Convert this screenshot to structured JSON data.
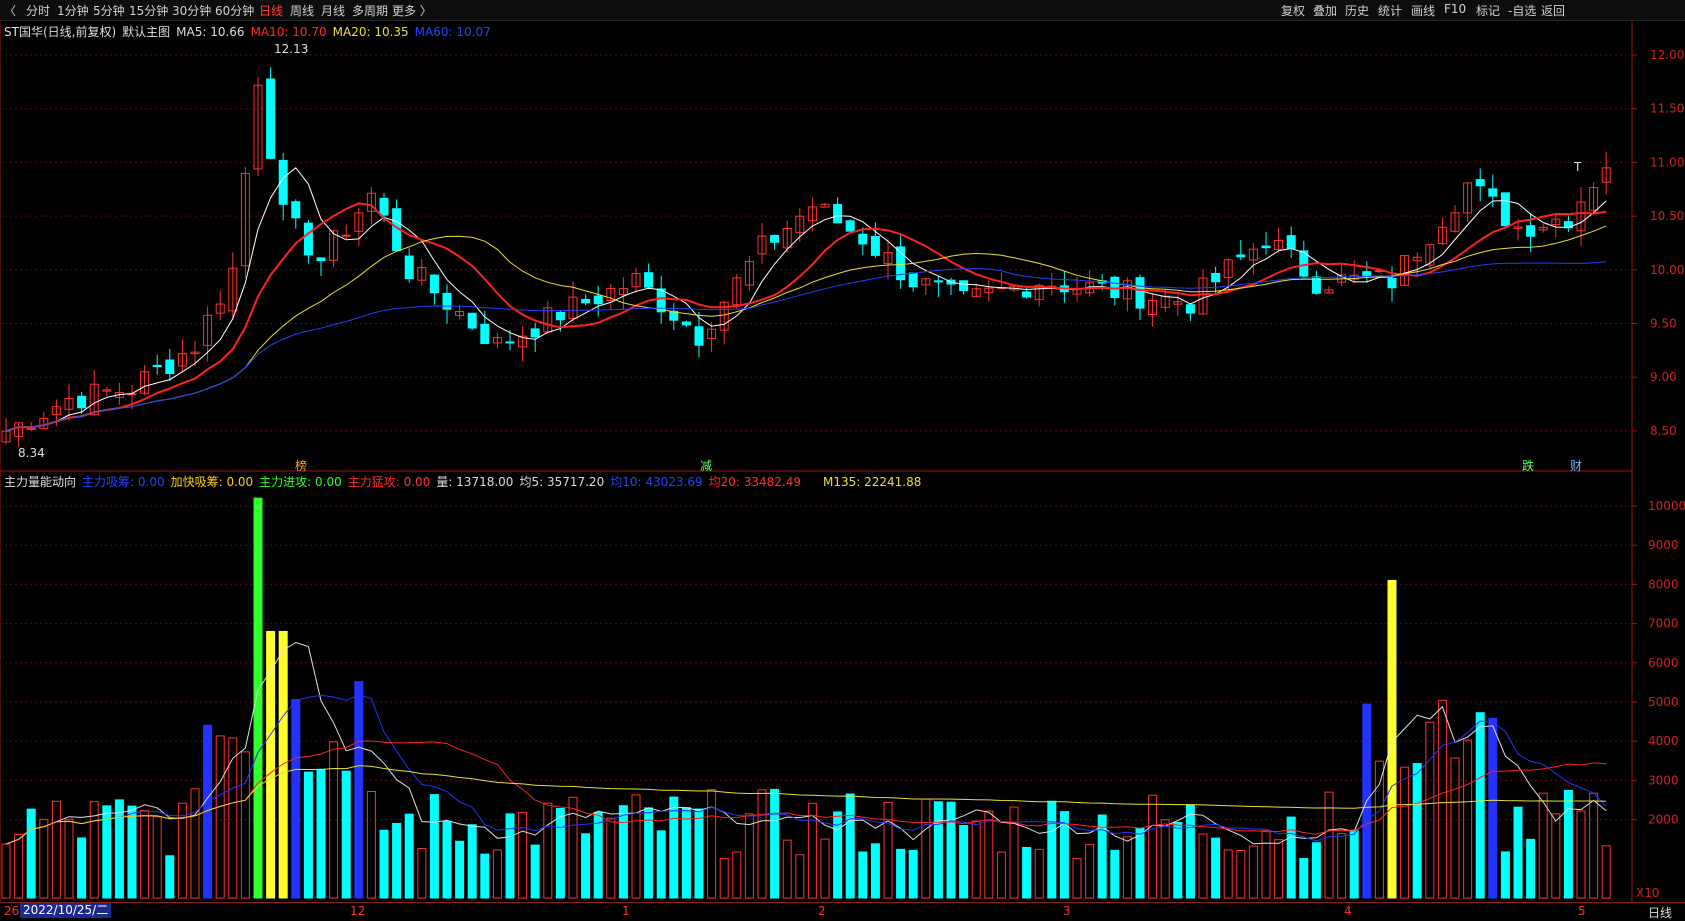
{
  "toolbar": {
    "periods": [
      "分时",
      "1分钟",
      "5分钟",
      "15分钟",
      "30分钟",
      "60分钟",
      "日线",
      "周线",
      "月线",
      "多周期",
      "更多 〉"
    ],
    "active_period": "日线",
    "right": [
      "复权",
      "叠加",
      "历史",
      "统计",
      "画线",
      "F10",
      "标记",
      "-自选",
      "返回"
    ]
  },
  "main_header": {
    "stock": "ST国华(日线,前复权)",
    "template": "默认主图",
    "ma5": "MA5: 10.66",
    "ma10": "MA10: 10.70",
    "ma20": "MA20: 10.35",
    "ma60": "MA60: 10.07"
  },
  "main_chart": {
    "high_label": "12.13",
    "low_label": "8.34",
    "t_marker": "T",
    "yticks": [
      "12.00",
      "11.50",
      "11.00",
      "10.50",
      "10.00",
      "9.50",
      "9.00",
      "8.50"
    ],
    "events": [
      "榜",
      "减",
      "跌",
      "财"
    ],
    "colors": {
      "up": "#ff3030",
      "down": "#00ffff",
      "ma5": "#ffffff",
      "ma10": "#ff2020",
      "ma20": "#e8e030",
      "ma60": "#2040ff"
    }
  },
  "sub_header": {
    "name": "主力量能动向",
    "s1": "主力吸筹: 0.00",
    "s2": "加快吸筹: 0.00",
    "s3": "主力进攻: 0.00",
    "s4": "主力猛攻: 0.00",
    "vol": "量: 13718.00",
    "avg5": "均5: 35717.20",
    "avg10": "均10: 43023.69",
    "avg20": "均20: 33482.49",
    "m135": "M135: 22241.88"
  },
  "sub_chart": {
    "yticks": [
      "10000",
      "9000",
      "8000",
      "7000",
      "6000",
      "5000",
      "4000",
      "3000",
      "2000"
    ],
    "unit": "X10"
  },
  "bottom": {
    "date": "2022/10/25/二",
    "month_marks": [
      "26",
      "12",
      "1",
      "2",
      "3",
      "4",
      "5"
    ],
    "label": "日线"
  }
}
